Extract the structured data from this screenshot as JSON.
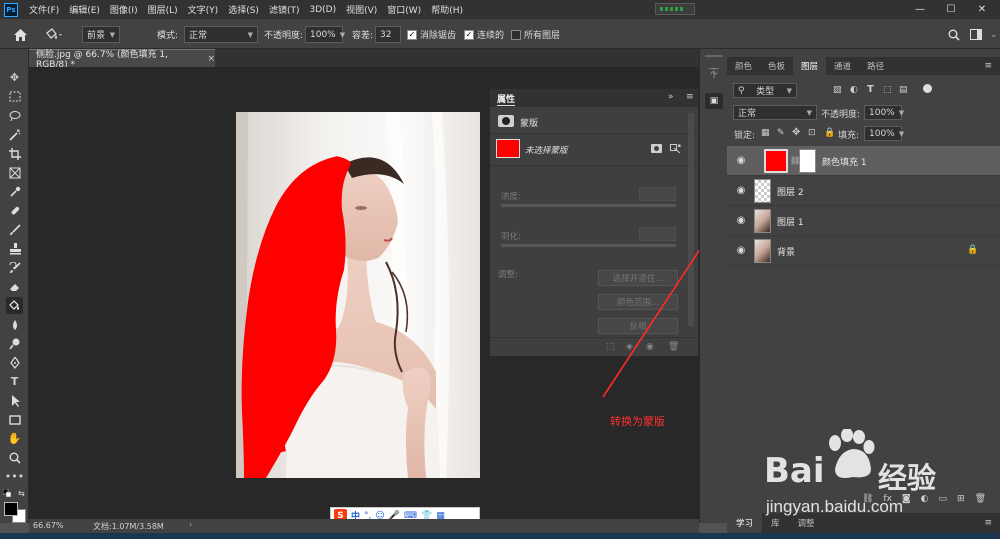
{
  "menubar": {
    "logo": "Ps",
    "items": [
      "文件(F)",
      "编辑(E)",
      "图像(I)",
      "图层(L)",
      "文字(Y)",
      "选择(S)",
      "滤镜(T)",
      "3D(D)",
      "视图(V)",
      "窗口(W)",
      "帮助(H)"
    ],
    "win_controls": [
      "—",
      "☐",
      "✕"
    ]
  },
  "options": {
    "fill_source": "前景",
    "mode_label": "模式:",
    "mode_value": "正常",
    "opacity_label": "不透明度:",
    "opacity_value": "100%",
    "tolerance_label": "容差:",
    "tolerance_value": "32",
    "antialias_label": "消除锯齿",
    "contiguous_label": "连续的",
    "all_layers_label": "所有图层"
  },
  "document": {
    "tab_title": "侧脸.jpg @ 66.7% (颜色填充 1, RGB/8) *",
    "tab_close": "×"
  },
  "status": {
    "zoom": "66.67%",
    "doc_size": "文档:1.07M/3.58M"
  },
  "properties": {
    "tab_label": "属性",
    "collapse": "»",
    "menu": "≡",
    "mask_type": "蒙版",
    "mask_state": "未选择蒙版",
    "density_label": "浓度:",
    "feather_label": "羽化:",
    "adjust_label": "调整:",
    "select_subject_btn": "选择并遮住...",
    "color_range_btn": "颜色范围...",
    "invert_btn": "反相"
  },
  "layers_panel": {
    "tabs": [
      "颜色",
      "色板",
      "图层",
      "通道",
      "路径"
    ],
    "active_tab": "图层",
    "filter_kind": "类型",
    "blend_mode": "正常",
    "opacity_label": "不透明度:",
    "opacity_value": "100%",
    "lock_label": "锁定:",
    "fill_label": "填充:",
    "fill_value": "100%",
    "layers": [
      {
        "name": "颜色填充 1",
        "selected": true
      },
      {
        "name": "图层 2",
        "selected": false
      },
      {
        "name": "图层 1",
        "selected": false
      },
      {
        "name": "背景",
        "selected": false
      }
    ],
    "bottom_tabs": [
      "学习",
      "库",
      "调整"
    ]
  },
  "annotation": {
    "text": "转换为蒙版",
    "color": "#ff3030"
  },
  "ime_bar": {
    "logo": "S",
    "lang": "中"
  },
  "watermark": {
    "brand": "Bai",
    "brand_suffix": "经验",
    "url": "jingyan.baidu.com"
  },
  "colors": {
    "fill_red": "#ff0000",
    "panel_dark": "#323232",
    "panel": "#424242",
    "canvas": "#282828"
  }
}
